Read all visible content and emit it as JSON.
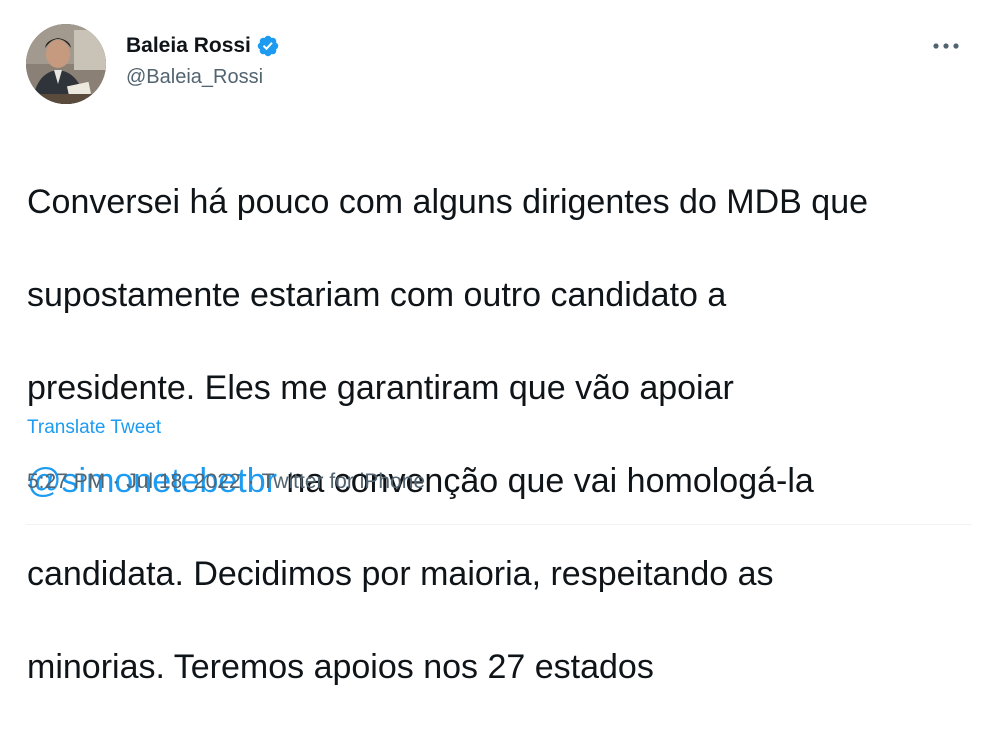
{
  "author": {
    "name": "Baleia Rossi",
    "handle": "@Baleia_Rossi",
    "verified_icon": "verified-badge-icon",
    "avatar_icon": "profile-photo"
  },
  "menu": {
    "icon": "more-horizontal-icon"
  },
  "tweet": {
    "line1": "Conversei há pouco com alguns dirigentes do MDB que",
    "line2": "supostamente estariam com outro candidato a",
    "line3": "presidente. Eles me garantiram que vão apoiar",
    "mention": "@simonetebetbr",
    "line4_rest": " na convenção que vai homologá-la",
    "line5": "candidata. Decidimos por maioria, respeitando as",
    "line6": "minorias. Teremos apoios nos 27 estados"
  },
  "translate_label": "Translate Tweet",
  "meta": {
    "time": "5:27 PM",
    "separator": "·",
    "date": "Jul 18, 2022",
    "source": "Twitter for iPhone"
  },
  "colors": {
    "link": "#1d9bf0",
    "secondary_text": "#536471",
    "primary_text": "#0f1419"
  }
}
